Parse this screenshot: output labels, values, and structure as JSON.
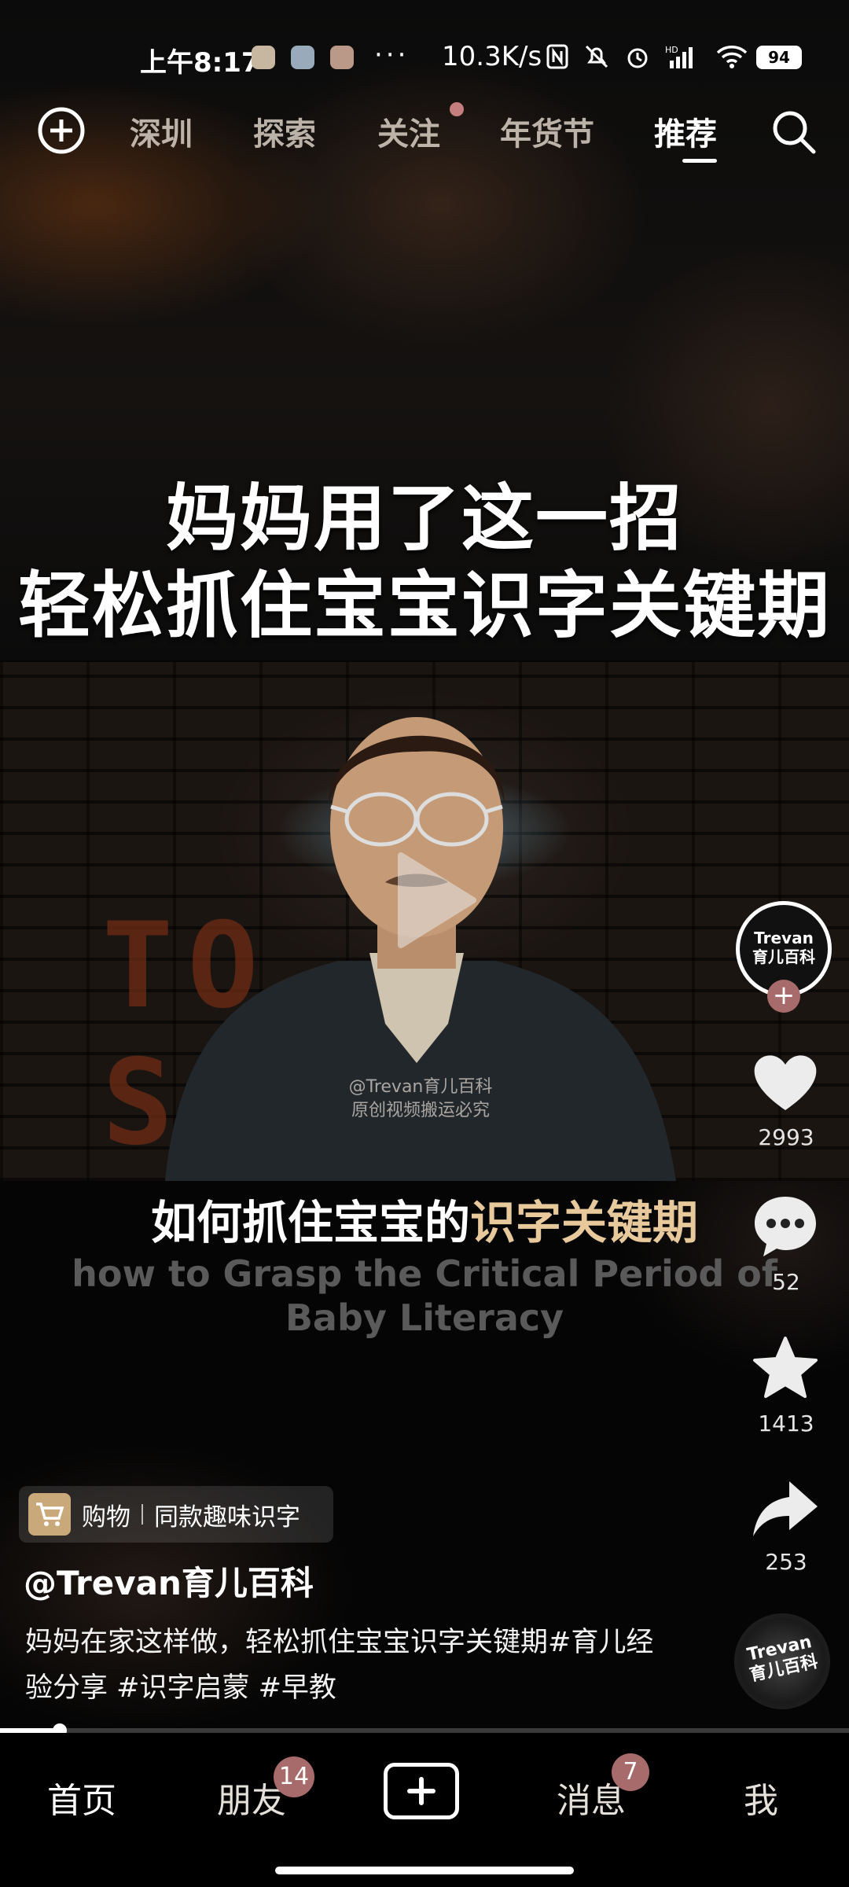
{
  "status_bar": {
    "time": "上午8:17",
    "dots": "···",
    "net_speed": "10.3K/s",
    "battery": "94"
  },
  "top_nav": {
    "tabs": [
      "深圳",
      "探索",
      "关注",
      "年货节",
      "推荐"
    ],
    "active_tab": "推荐",
    "icons": {
      "add": "add-circle-icon",
      "search": "search-icon"
    }
  },
  "video": {
    "title_line1": "妈妈用了这一招",
    "title_line2": "轻松抓住宝宝识字关键期",
    "graffiti_text": "TO SCHOOL",
    "watermark_line1": "@Trevan育儿百科",
    "watermark_line2": "原创视频搬运必究",
    "subtitle_cn_plain": "如何抓住宝宝的",
    "subtitle_cn_highlight": "识字关键期",
    "subtitle_en": "how to Grasp the Critical Period of Baby Literacy",
    "progress": 0.07
  },
  "actions": {
    "avatar_line1": "Trevan",
    "avatar_line2": "育儿百科",
    "likes": "2993",
    "comments": "52",
    "favorites": "1413",
    "shares": "253"
  },
  "music_disc": {
    "line1": "Trevan",
    "line2": "育儿百科"
  },
  "shop": {
    "label": "购物",
    "item": "同款趣味识字"
  },
  "post": {
    "username": "@Trevan育儿百科",
    "description": "妈妈在家这样做，轻松抓住宝宝识字关键期#育儿经验分享 #识字启蒙 #早教"
  },
  "bottom_nav": {
    "home": "首页",
    "friends": "朋友",
    "friends_badge": "14",
    "messages": "消息",
    "messages_badge": "7",
    "me": "我"
  },
  "colors": {
    "accent": "#e7c99c",
    "badge": "#a86b6b"
  }
}
